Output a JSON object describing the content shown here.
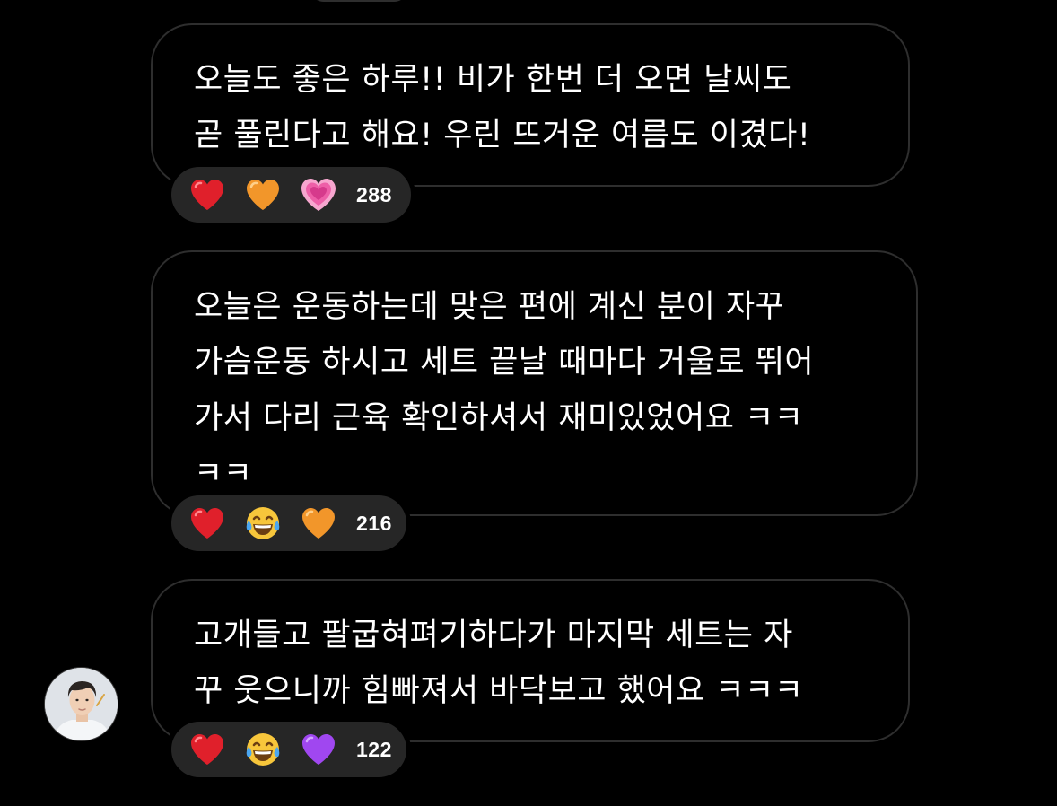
{
  "messages": [
    {
      "text": "오늘도 좋은 하루!! 비가 한번 더 오면 날씨도\n곧 풀린다고 해요! 우린 뜨거운 여름도 이겼다!",
      "reactions": {
        "emojis": [
          "red-heart",
          "orange-heart",
          "growing-heart"
        ],
        "count": "288"
      }
    },
    {
      "text": "오늘은 운동하는데 맞은 편에 계신 분이 자꾸\n가슴운동 하시고 세트 끝날 때마다 거울로 뛰어\n가서 다리 근육 확인하셔서 재미있었어요 ㅋㅋ\nㅋㅋ",
      "reactions": {
        "emojis": [
          "red-heart",
          "tears-of-joy",
          "orange-heart"
        ],
        "count": "216"
      }
    },
    {
      "text": "고개들고 팔굽혀펴기하다가 마지막 세트는 자\n꾸 웃으니까 힘빠져서 바닥보고 했어요 ㅋㅋㅋ",
      "reactions": {
        "emojis": [
          "red-heart",
          "tears-of-joy",
          "purple-heart"
        ],
        "count": "122"
      }
    }
  ],
  "colors": {
    "background": "#000000",
    "bubble_border": "#2e2e2e",
    "reaction_pill": "#262626",
    "text": "#ffffff",
    "red_heart": "#e0202b",
    "orange_heart": "#f2962a",
    "pink_heart": "#ee5fa8",
    "purple_heart": "#a047f0",
    "tears_face": "#f7c63b"
  }
}
